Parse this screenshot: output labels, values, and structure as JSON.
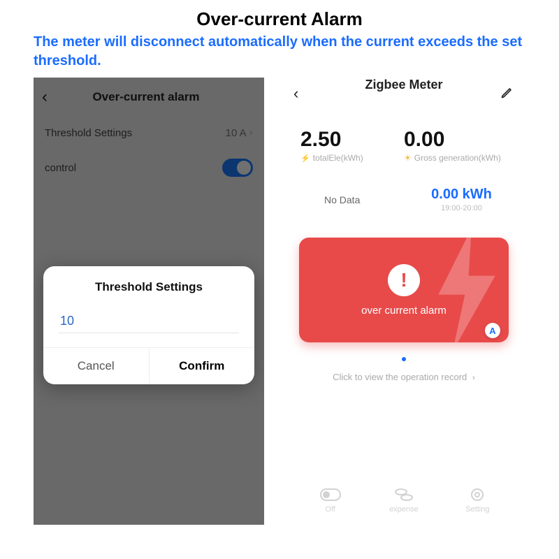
{
  "title": "Over-current Alarm",
  "subtitle": "The meter will disconnect automatically when the current exceeds the set threshold.",
  "left": {
    "header": "Over-current alarm",
    "threshold_label": "Threshold Settings",
    "threshold_value": "10 A",
    "control_label": "control",
    "control_on": true,
    "dialog": {
      "title": "Threshold Settings",
      "input_value": "10",
      "cancel": "Cancel",
      "confirm": "Confirm"
    }
  },
  "right": {
    "title": "Zigbee Meter",
    "total_ele": {
      "value": "2.50",
      "label": "totalEle(kWh)"
    },
    "gross_gen": {
      "value": "0.00",
      "label": "Gross generation(kWh)"
    },
    "no_data": "No Data",
    "kwh": {
      "value": "0.00 kWh",
      "time": "19:00-20:00"
    },
    "alarm_text": "over current alarm",
    "a_badge": "A",
    "op_record": "Click to view the operation record",
    "tabs": {
      "off": "Off",
      "expense": "expense",
      "setting": "Setting"
    }
  }
}
